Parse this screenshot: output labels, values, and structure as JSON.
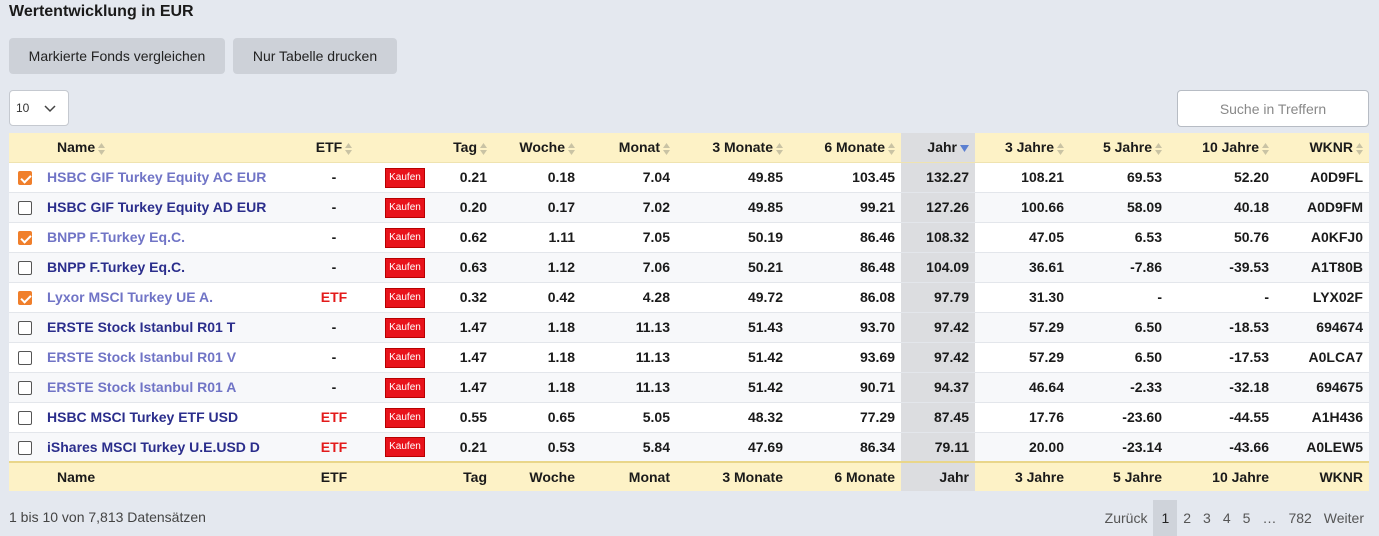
{
  "title": "Wertentwicklung in EUR",
  "buttons": {
    "compare": "Markierte Fonds vergleichen",
    "print": "Nur Tabelle drucken"
  },
  "page_size": "10",
  "search_placeholder": "Suche in Treffern",
  "columns": [
    "Name",
    "ETF",
    "Tag",
    "Woche",
    "Monat",
    "3 Monate",
    "6 Monate",
    "Jahr",
    "3 Jahre",
    "5 Jahre",
    "10 Jahre",
    "WKNR"
  ],
  "buy_label": "Kaufen",
  "rows": [
    {
      "checked": true,
      "name": "HSBC GIF Turkey Equity AC EUR",
      "etf": "-",
      "tag": "0.21",
      "woche": "0.18",
      "monat": "7.04",
      "m3": "49.85",
      "m6": "103.45",
      "jahr": "132.27",
      "j3": "108.21",
      "j5": "69.53",
      "j10": "52.20",
      "wknr": "A0D9FL"
    },
    {
      "checked": false,
      "name": "HSBC GIF Turkey Equity AD EUR",
      "etf": "-",
      "tag": "0.20",
      "woche": "0.17",
      "monat": "7.02",
      "m3": "49.85",
      "m6": "99.21",
      "jahr": "127.26",
      "j3": "100.66",
      "j5": "58.09",
      "j10": "40.18",
      "wknr": "A0D9FM"
    },
    {
      "checked": true,
      "name": "BNPP F.Turkey Eq.C.",
      "etf": "-",
      "tag": "0.62",
      "woche": "1.11",
      "monat": "7.05",
      "m3": "50.19",
      "m6": "86.46",
      "jahr": "108.32",
      "j3": "47.05",
      "j5": "6.53",
      "j10": "50.76",
      "wknr": "A0KFJ0"
    },
    {
      "checked": false,
      "name": "BNPP F.Turkey Eq.C.",
      "etf": "-",
      "tag": "0.63",
      "woche": "1.12",
      "monat": "7.06",
      "m3": "50.21",
      "m6": "86.48",
      "jahr": "104.09",
      "j3": "36.61",
      "j5": "-7.86",
      "j10": "-39.53",
      "wknr": "A1T80B"
    },
    {
      "checked": true,
      "name": "Lyxor MSCI Turkey UE A.",
      "etf": "ETF",
      "tag": "0.32",
      "woche": "0.42",
      "monat": "4.28",
      "m3": "49.72",
      "m6": "86.08",
      "jahr": "97.79",
      "j3": "31.30",
      "j5": "-",
      "j10": "-",
      "wknr": "LYX02F"
    },
    {
      "checked": false,
      "name": "ERSTE Stock Istanbul R01 T",
      "etf": "-",
      "tag": "1.47",
      "woche": "1.18",
      "monat": "11.13",
      "m3": "51.43",
      "m6": "93.70",
      "jahr": "97.42",
      "j3": "57.29",
      "j5": "6.50",
      "j10": "-18.53",
      "wknr": "694674"
    },
    {
      "checked": false,
      "name": "ERSTE Stock Istanbul R01 V",
      "etf": "-",
      "tag": "1.47",
      "woche": "1.18",
      "monat": "11.13",
      "m3": "51.42",
      "m6": "93.69",
      "jahr": "97.42",
      "j3": "57.29",
      "j5": "6.50",
      "j10": "-17.53",
      "wknr": "A0LCA7"
    },
    {
      "checked": false,
      "name": "ERSTE Stock Istanbul R01 A",
      "etf": "-",
      "tag": "1.47",
      "woche": "1.18",
      "monat": "11.13",
      "m3": "51.42",
      "m6": "90.71",
      "jahr": "94.37",
      "j3": "46.64",
      "j5": "-2.33",
      "j10": "-32.18",
      "wknr": "694675"
    },
    {
      "checked": false,
      "name": "HSBC MSCI Turkey ETF USD",
      "etf": "ETF",
      "tag": "0.55",
      "woche": "0.65",
      "monat": "5.05",
      "m3": "48.32",
      "m6": "77.29",
      "jahr": "87.45",
      "j3": "17.76",
      "j5": "-23.60",
      "j10": "-44.55",
      "wknr": "A1H436"
    },
    {
      "checked": false,
      "name": "iShares MSCI Turkey U.E.USD D",
      "etf": "ETF",
      "tag": "0.21",
      "woche": "0.53",
      "monat": "5.84",
      "m3": "47.69",
      "m6": "86.34",
      "jahr": "79.11",
      "j3": "20.00",
      "j5": "-23.14",
      "j10": "-43.66",
      "wknr": "A0LEW5"
    }
  ],
  "visited_rows": [
    2,
    4,
    6,
    7
  ],
  "info": "1 bis 10 von 7,813 Datensätzen",
  "pager": {
    "prev": "Zurück",
    "pages": [
      "1",
      "2",
      "3",
      "4",
      "5"
    ],
    "dots": "…",
    "last": "782",
    "next": "Weiter",
    "active": "1"
  }
}
